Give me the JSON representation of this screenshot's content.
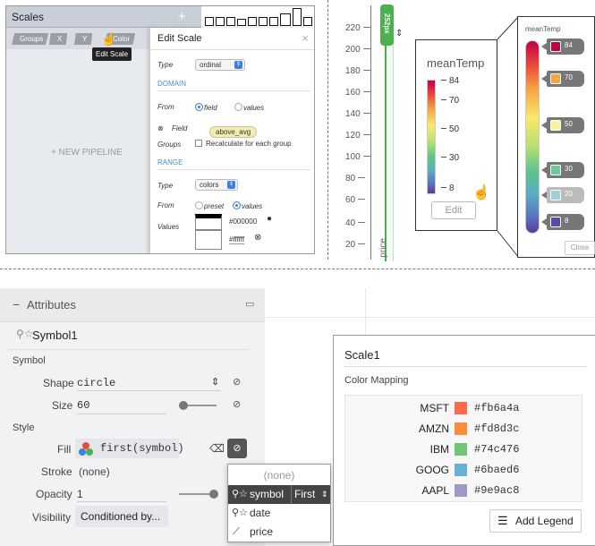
{
  "panelA": {
    "title": "Scales",
    "add_label": "+",
    "chips": [
      "Groups",
      "X",
      "Y",
      "Color"
    ],
    "tooltip": "Edit Scale",
    "new_pipeline": "+ NEW PIPELINE",
    "dialog": {
      "title": "Edit Scale",
      "close": "×",
      "type_label": "Type",
      "type_value": "ordinal",
      "domain_header": "DOMAIN",
      "from_label": "From",
      "from_opt1": "field",
      "from_opt2": "values",
      "field_label": "Field",
      "field_value": "above_avg",
      "groups_label": "Groups",
      "recalc_label": "Recalculate for each group",
      "range_header": "RANGE",
      "range_type_label": "Type",
      "range_type_value": "colors",
      "range_from_label": "From",
      "range_from_opt1": "preset",
      "range_from_opt2": "values",
      "values_label": "Values",
      "value1": "#000000",
      "value2": "#ffffff"
    }
  },
  "panelB": {
    "yticks": [
      "220",
      "200",
      "180",
      "160",
      "140",
      "120",
      "100",
      "80",
      "60",
      "40",
      "20"
    ],
    "brush_label": "252px",
    "axis_label": "price",
    "legend_title": "meanTemp",
    "legend_ticks": [
      "84",
      "70",
      "50",
      "30",
      "8"
    ],
    "edit_label": "Edit",
    "legend2_title": "meanTemp",
    "legend2_values": [
      {
        "label": "84",
        "color": "#c1004a"
      },
      {
        "label": "70",
        "color": "#f5a443"
      },
      {
        "label": "50",
        "color": "#fbf19a"
      },
      {
        "label": "30",
        "color": "#6cc99a"
      },
      {
        "label": "20",
        "color": "#9fd1d4"
      },
      {
        "label": "8",
        "color": "#5a48a8"
      }
    ],
    "close_label": "Close"
  },
  "panelC": {
    "header": "Attributes",
    "collapse": "−",
    "symbol_name": "Symbol1",
    "symbol_section": "Symbol",
    "shape_label": "Shape",
    "shape_value": "circle",
    "size_label": "Size",
    "size_value": "60",
    "style_section": "Style",
    "fill_label": "Fill",
    "fill_value": "first(symbol)",
    "stroke_label": "Stroke",
    "stroke_value": "(none)",
    "opacity_label": "Opacity",
    "opacity_value": "1",
    "visibility_label": "Visibility",
    "visibility_value": "Conditioned by...",
    "dropdown": {
      "none": "(none)",
      "symbol": "symbol",
      "agg": "First",
      "date": "date",
      "price": "price"
    },
    "scale": {
      "title": "Scale1",
      "section": "Color Mapping",
      "rows": [
        {
          "name": "MSFT",
          "hex": "#fb6a4a"
        },
        {
          "name": "AMZN",
          "hex": "#fd8d3c"
        },
        {
          "name": "IBM",
          "hex": "#74c476"
        },
        {
          "name": "GOOG",
          "hex": "#6baed6"
        },
        {
          "name": "AAPL",
          "hex": "#9e9ac8"
        }
      ],
      "add_legend": "Add Legend"
    }
  }
}
